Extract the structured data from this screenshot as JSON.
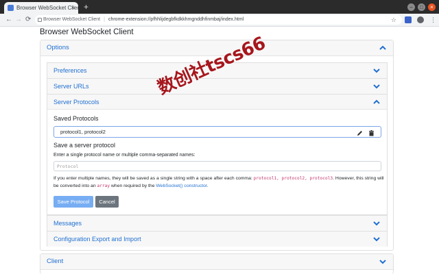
{
  "browser": {
    "tab_title": "Browser WebSocket Client",
    "tab_close": "×",
    "new_tab": "+",
    "window_controls": [
      "–",
      "□",
      "×"
    ],
    "nav": {
      "back": "←",
      "forward": "→",
      "reload": "⟳"
    },
    "address_origin": "Browser WebSocket Client",
    "address_url": "chrome-extension://pfhhlijdegbfkdkkhmgnddhfinmbaj/index.html",
    "star": "☆",
    "menu": "⋮"
  },
  "page": {
    "title": "Browser WebSocket Client",
    "options": {
      "label": "Options"
    },
    "preferences": {
      "label": "Preferences"
    },
    "server_urls": {
      "label": "Server URLs"
    },
    "server_protocols": {
      "label": "Server Protocols",
      "saved_heading": "Saved Protocols",
      "saved_item": "protocol1, protocol2",
      "save_heading": "Save a server protocol",
      "hint": "Enter a single protocol name or multiple comma-separated names:",
      "input_placeholder": "Protocol",
      "note_before": "If you enter multiple names, they will be saved as a single string with a space after each comma:",
      "note_code": "protocol1, protocol2, protocol3",
      "note_middle": ". However, this string will be converted into an",
      "note_array": "array",
      "note_after_array": "when required by the",
      "note_link": "WebSocket() constructor",
      "note_end": ".",
      "save_button": "Save Protocol",
      "cancel_button": "Cancel"
    },
    "messages": {
      "label": "Messages"
    },
    "config_export": {
      "label": "Configuration Export and Import"
    },
    "client": {
      "label": "Client"
    }
  },
  "watermark": "数创社tscs66",
  "colors": {
    "link_blue": "#1f6fd1",
    "save_button": "#77adf2",
    "cancel_button": "#6c757d",
    "code_pink": "#c4336b",
    "watermark": "#a6161c"
  }
}
